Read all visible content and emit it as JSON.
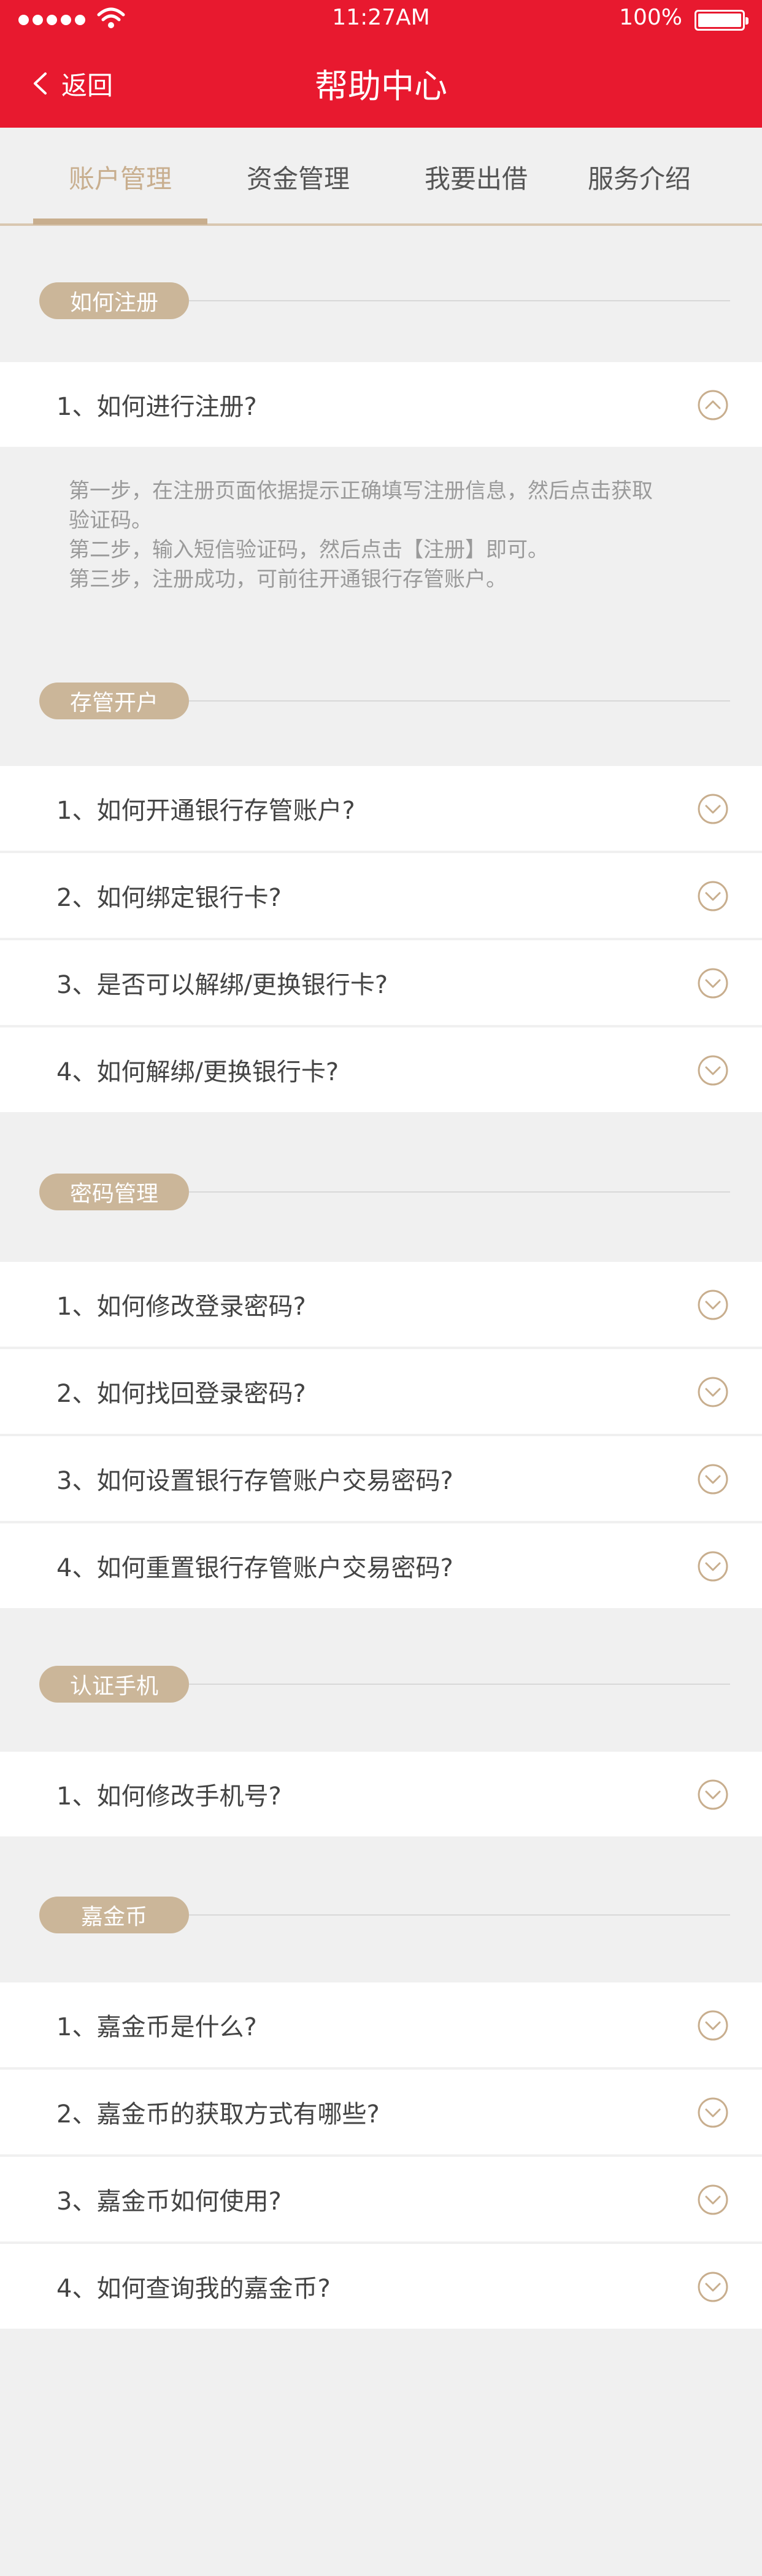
{
  "status_bar": {
    "time": "11:27AM",
    "battery": "100%",
    "signal_icon": "signal-dots-icon",
    "wifi_icon": "wifi-icon",
    "battery_icon": "battery-icon"
  },
  "nav": {
    "back_label": "返回",
    "title": "帮助中心"
  },
  "tabs": [
    {
      "label": "账户管理",
      "active": true
    },
    {
      "label": "资金管理",
      "active": false
    },
    {
      "label": "我要出借",
      "active": false
    },
    {
      "label": "服务介绍",
      "active": false
    }
  ],
  "colors": {
    "header_red": "#e8192f",
    "accent_gold": "#c8ae8e",
    "pill_bg": "#cbb699",
    "page_bg": "#f0f0f0"
  },
  "sections": [
    {
      "title": "如何注册",
      "items": [
        {
          "question": "1、如何进行注册?",
          "expanded": true,
          "answer": [
            "第一步，在注册页面依据提示正确填写注册信息，然后点击获取",
            "验证码。",
            "第二步，输入短信验证码，然后点击【注册】即可。",
            "第三步，注册成功，可前往开通银行存管账户。"
          ]
        }
      ]
    },
    {
      "title": "存管开户",
      "items": [
        {
          "question": "1、如何开通银行存管账户?",
          "expanded": false
        },
        {
          "question": "2、如何绑定银行卡?",
          "expanded": false
        },
        {
          "question": "3、是否可以解绑/更换银行卡?",
          "expanded": false
        },
        {
          "question": "4、如何解绑/更换银行卡?",
          "expanded": false
        }
      ]
    },
    {
      "title": "密码管理",
      "items": [
        {
          "question": "1、如何修改登录密码?",
          "expanded": false
        },
        {
          "question": "2、如何找回登录密码?",
          "expanded": false
        },
        {
          "question": "3、如何设置银行存管账户交易密码?",
          "expanded": false
        },
        {
          "question": "4、如何重置银行存管账户交易密码?",
          "expanded": false
        }
      ]
    },
    {
      "title": "认证手机",
      "items": [
        {
          "question": "1、如何修改手机号?",
          "expanded": false
        }
      ]
    },
    {
      "title": "嘉金币",
      "items": [
        {
          "question": "1、嘉金币是什么?",
          "expanded": false
        },
        {
          "question": "2、嘉金币的获取方式有哪些?",
          "expanded": false
        },
        {
          "question": "3、嘉金币如何使用?",
          "expanded": false
        },
        {
          "question": "4、如何查询我的嘉金币?",
          "expanded": false
        }
      ]
    }
  ]
}
